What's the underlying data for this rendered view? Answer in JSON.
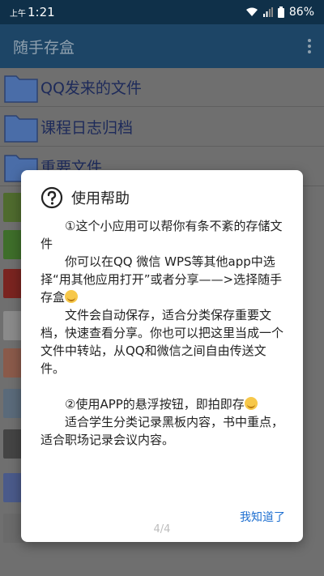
{
  "status_bar": {
    "am_pm": "上午",
    "time": "1:21",
    "battery": "86%"
  },
  "app": {
    "title": "随手存盒"
  },
  "list": {
    "items": [
      {
        "label": "QQ发来的文件",
        "icon": "folder-icon"
      },
      {
        "label": "课程日志归档",
        "icon": "folder-icon"
      },
      {
        "label": "重要文件",
        "icon": "folder-icon"
      }
    ]
  },
  "dialog": {
    "title": "使用帮助",
    "icon": "help-icon",
    "p1": "①这个小应用可以帮你有条不紊的存储文件",
    "p2": "你可以在QQ 微信 WPS等其他app中选择“用其他应用打开”或者分享——>选择随手存盒",
    "p3": "文件会自动保存，适合分类保存重要文档，快速查看分享。你也可以把这里当成一个文件中转站，从QQ和微信之间自由传送文件。",
    "p4": "②使用APP的悬浮按钮，即拍即存",
    "p5": "适合学生分类记录黑板内容，书中重点，适合职场记录会议内容。",
    "page_indicator": "4/4",
    "ok_label": "我知道了"
  },
  "colors": {
    "status_bar": "#0f3049",
    "app_bar": "#1d4566",
    "link": "#1e6fd0"
  }
}
